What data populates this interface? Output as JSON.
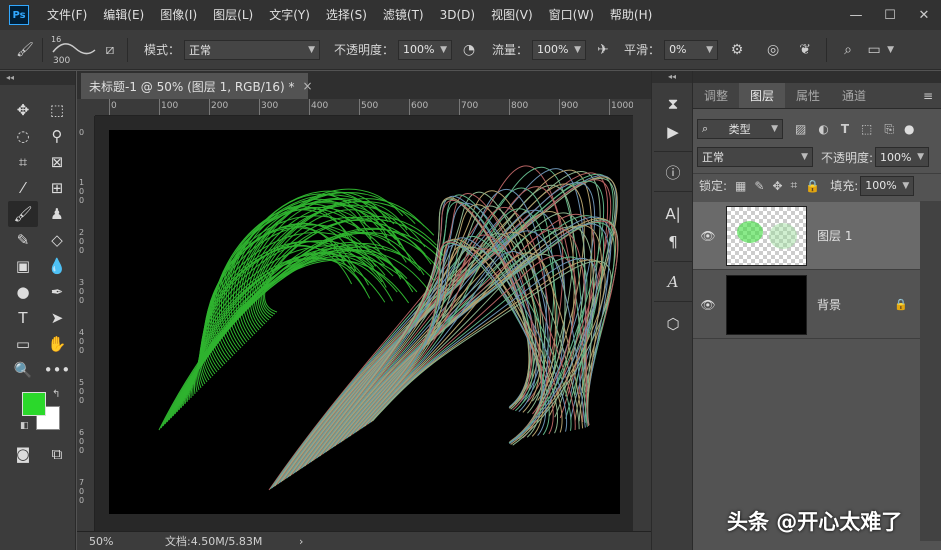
{
  "menubar": {
    "logo": "Ps",
    "items": [
      "文件(F)",
      "编辑(E)",
      "图像(I)",
      "图层(L)",
      "文字(Y)",
      "选择(S)",
      "滤镜(T)",
      "3D(D)",
      "视图(V)",
      "窗口(W)",
      "帮助(H)"
    ]
  },
  "options": {
    "brush_size": "300",
    "mode_label": "模式：",
    "mode_value": "正常",
    "opacity_label": "不透明度：",
    "opacity_value": "100%",
    "flow_label": "流量：",
    "flow_value": "100%",
    "smooth_label": "平滑：",
    "smooth_value": "0%"
  },
  "document": {
    "tab_title": "未标题-1 @ 50% (图层 1, RGB/16) *",
    "close": "×",
    "ruler_h": [
      "0",
      "100",
      "200",
      "300",
      "400",
      "500",
      "600",
      "700",
      "800",
      "900",
      "1000"
    ],
    "ruler_v": [
      "0",
      "1 0 0",
      "2 0 0",
      "3 0 0",
      "4 0 0",
      "5 0 0",
      "6 0 0",
      "7 0 0"
    ]
  },
  "status": {
    "zoom": "50%",
    "doc_size": "文档:4.50M/5.83M",
    "arrow": "›"
  },
  "panels": {
    "tabs": [
      "调整",
      "图层",
      "属性",
      "通道"
    ],
    "active_tab": "图层",
    "filter_kind": "类型",
    "blend_mode": "正常",
    "opacity_label": "不透明度:",
    "opacity_value": "100%",
    "lock_label": "锁定:",
    "fill_label": "填充:",
    "fill_value": "100%",
    "layers": [
      {
        "name": "图层 1",
        "selected": true
      },
      {
        "name": "背景",
        "selected": false,
        "locked": true
      }
    ]
  },
  "colors": {
    "foreground": "#2bd82b",
    "background": "#ffffff",
    "canvas": "#000000"
  },
  "watermark": "头条 @开心太难了"
}
